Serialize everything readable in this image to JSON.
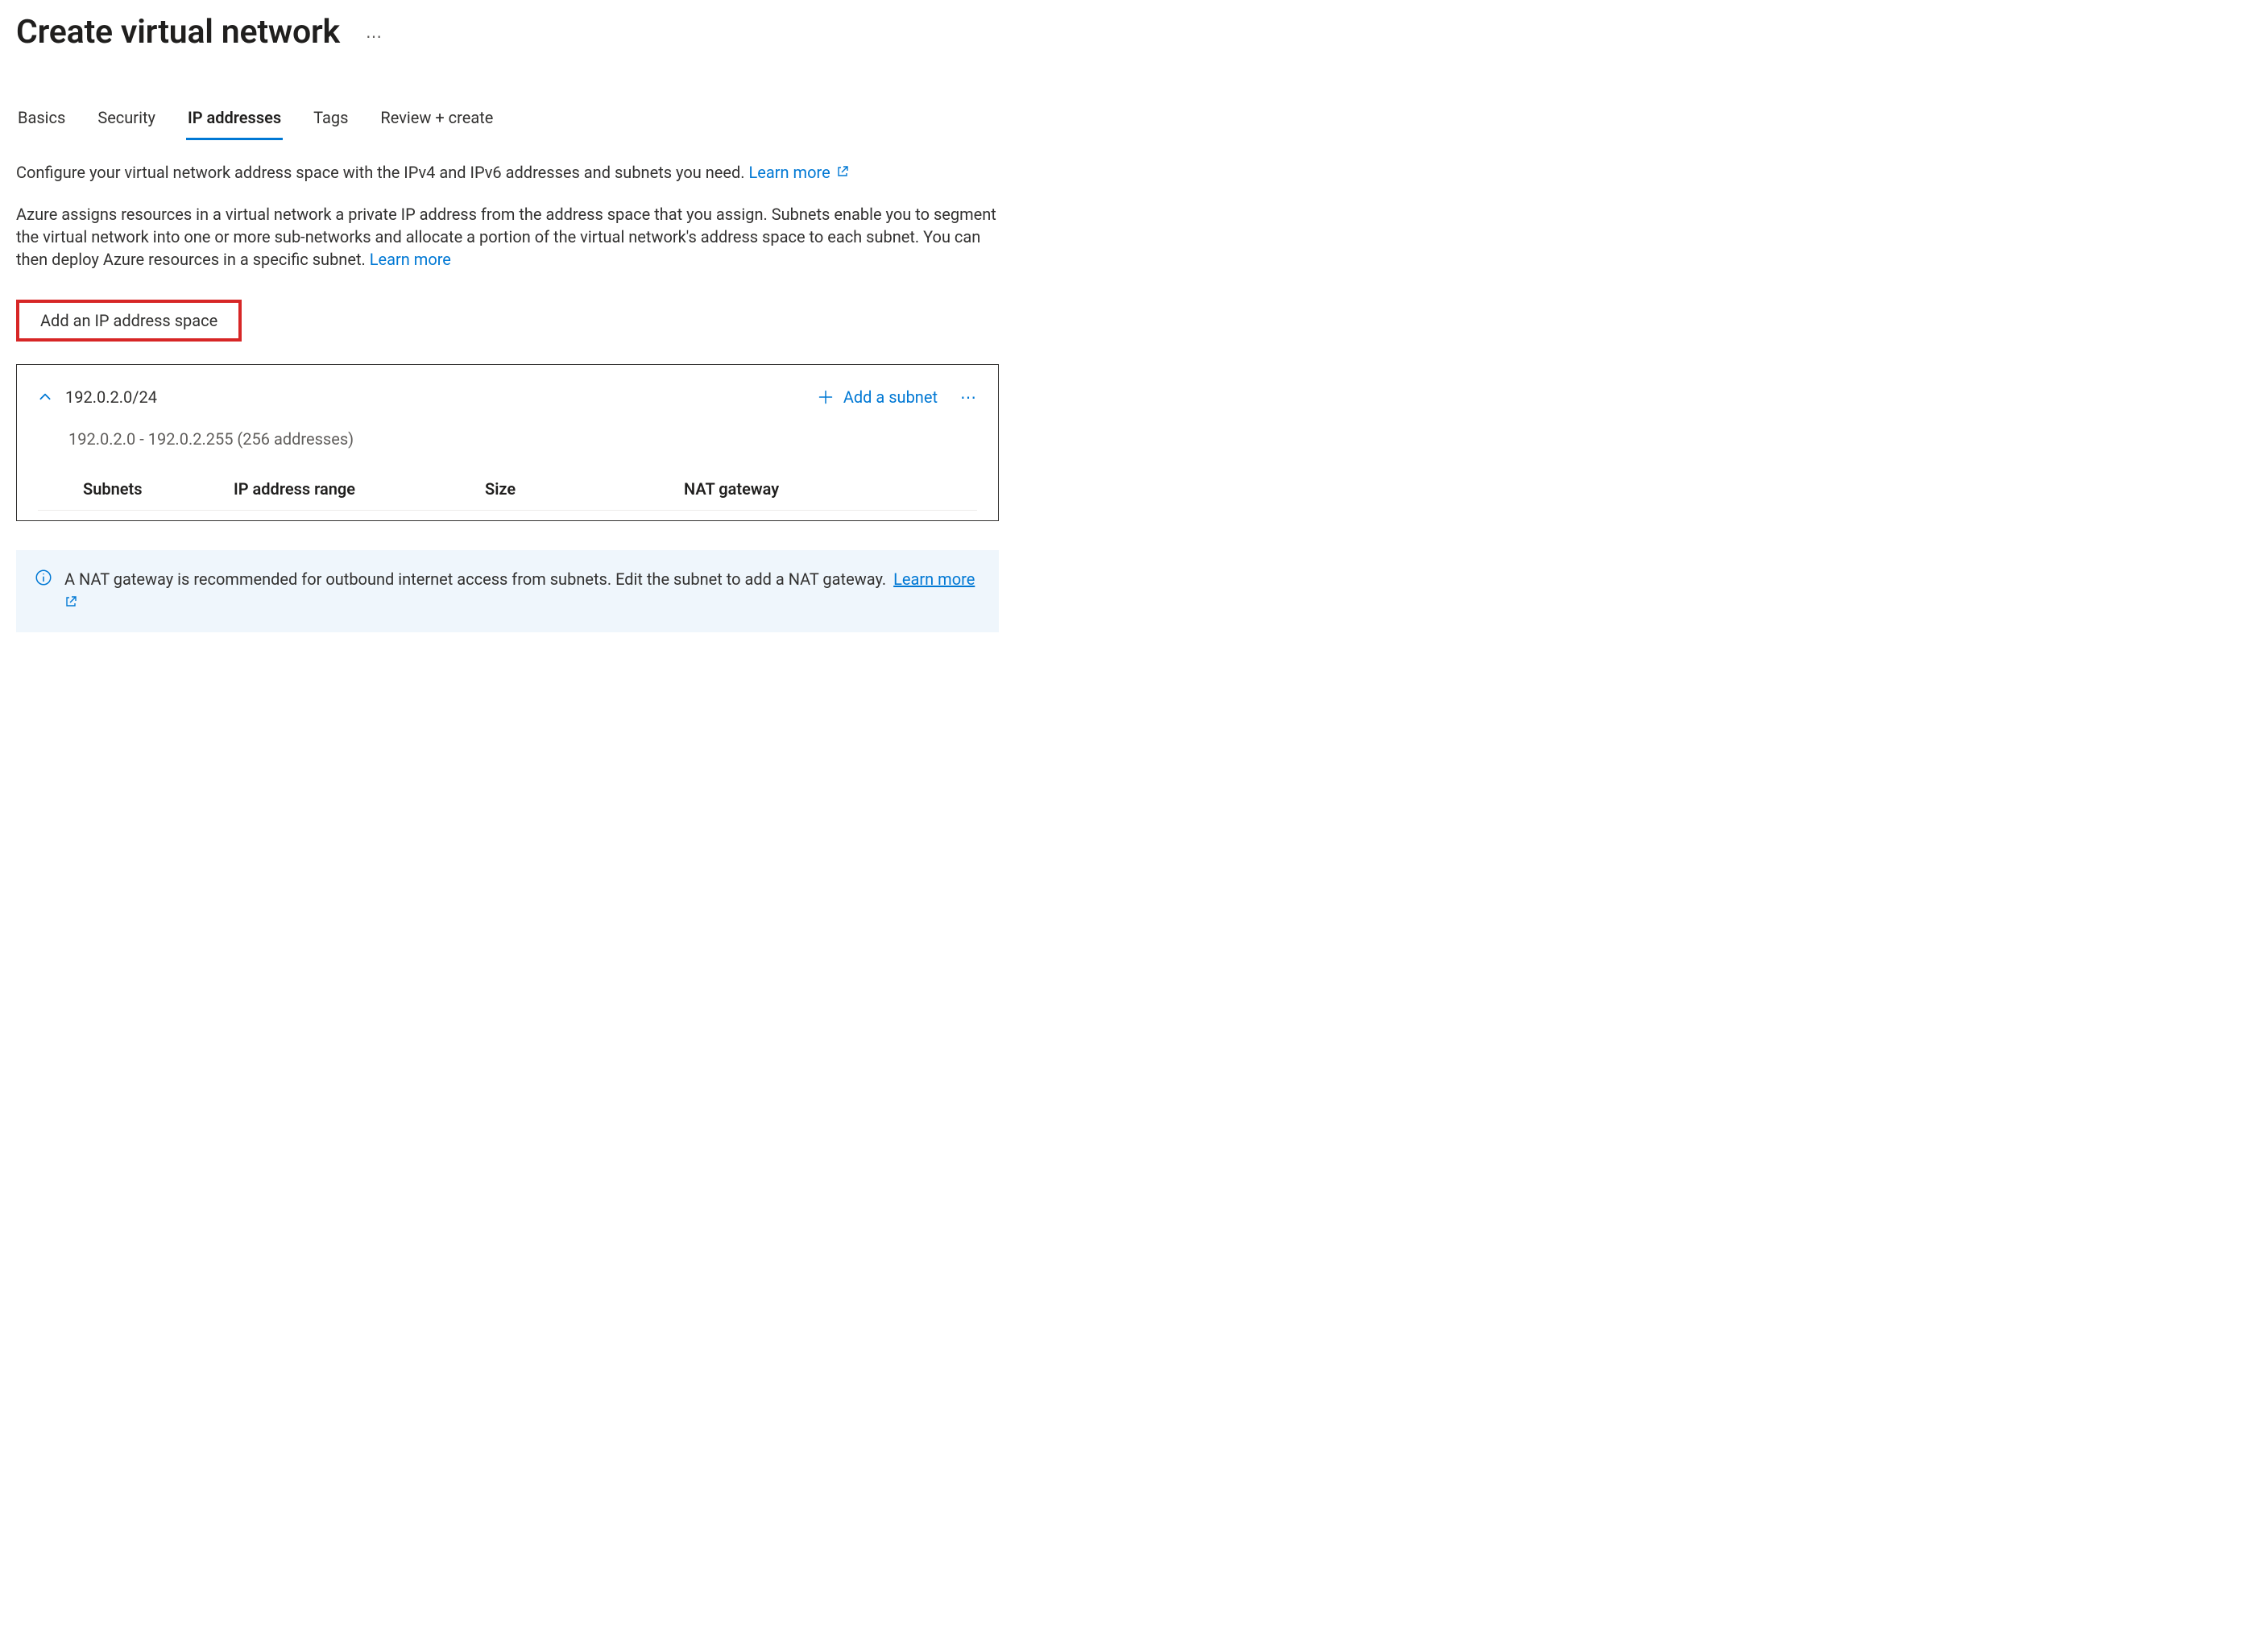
{
  "page": {
    "title": "Create virtual network"
  },
  "tabs": {
    "items": [
      {
        "label": "Basics"
      },
      {
        "label": "Security"
      },
      {
        "label": "IP addresses"
      },
      {
        "label": "Tags"
      },
      {
        "label": "Review + create"
      }
    ],
    "active_index": 2
  },
  "intro": {
    "para1_text": "Configure your virtual network address space with the IPv4 and IPv6 addresses and subnets you need.",
    "para1_learn": "Learn more",
    "para2_text": "Azure assigns resources in a virtual network a private IP address from the address space that you assign. Subnets enable you to segment the virtual network into one or more sub-networks and allocate a portion of the virtual network's address space to each subnet. You can then deploy Azure resources in a specific subnet.",
    "para2_learn": "Learn more"
  },
  "buttons": {
    "add_ip_space": "Add an IP address space",
    "add_subnet": "Add a subnet"
  },
  "address_space": {
    "cidr": "192.0.2.0/24",
    "range": "192.0.2.0 - 192.0.2.255 (256 addresses)"
  },
  "subnet_columns": {
    "subnets": "Subnets",
    "ip_range": "IP address range",
    "size": "Size",
    "nat_gateway": "NAT gateway"
  },
  "banner": {
    "text": "A NAT gateway is recommended for outbound internet access from subnets. Edit the subnet to add a NAT gateway.",
    "learn_more": "Learn more"
  }
}
